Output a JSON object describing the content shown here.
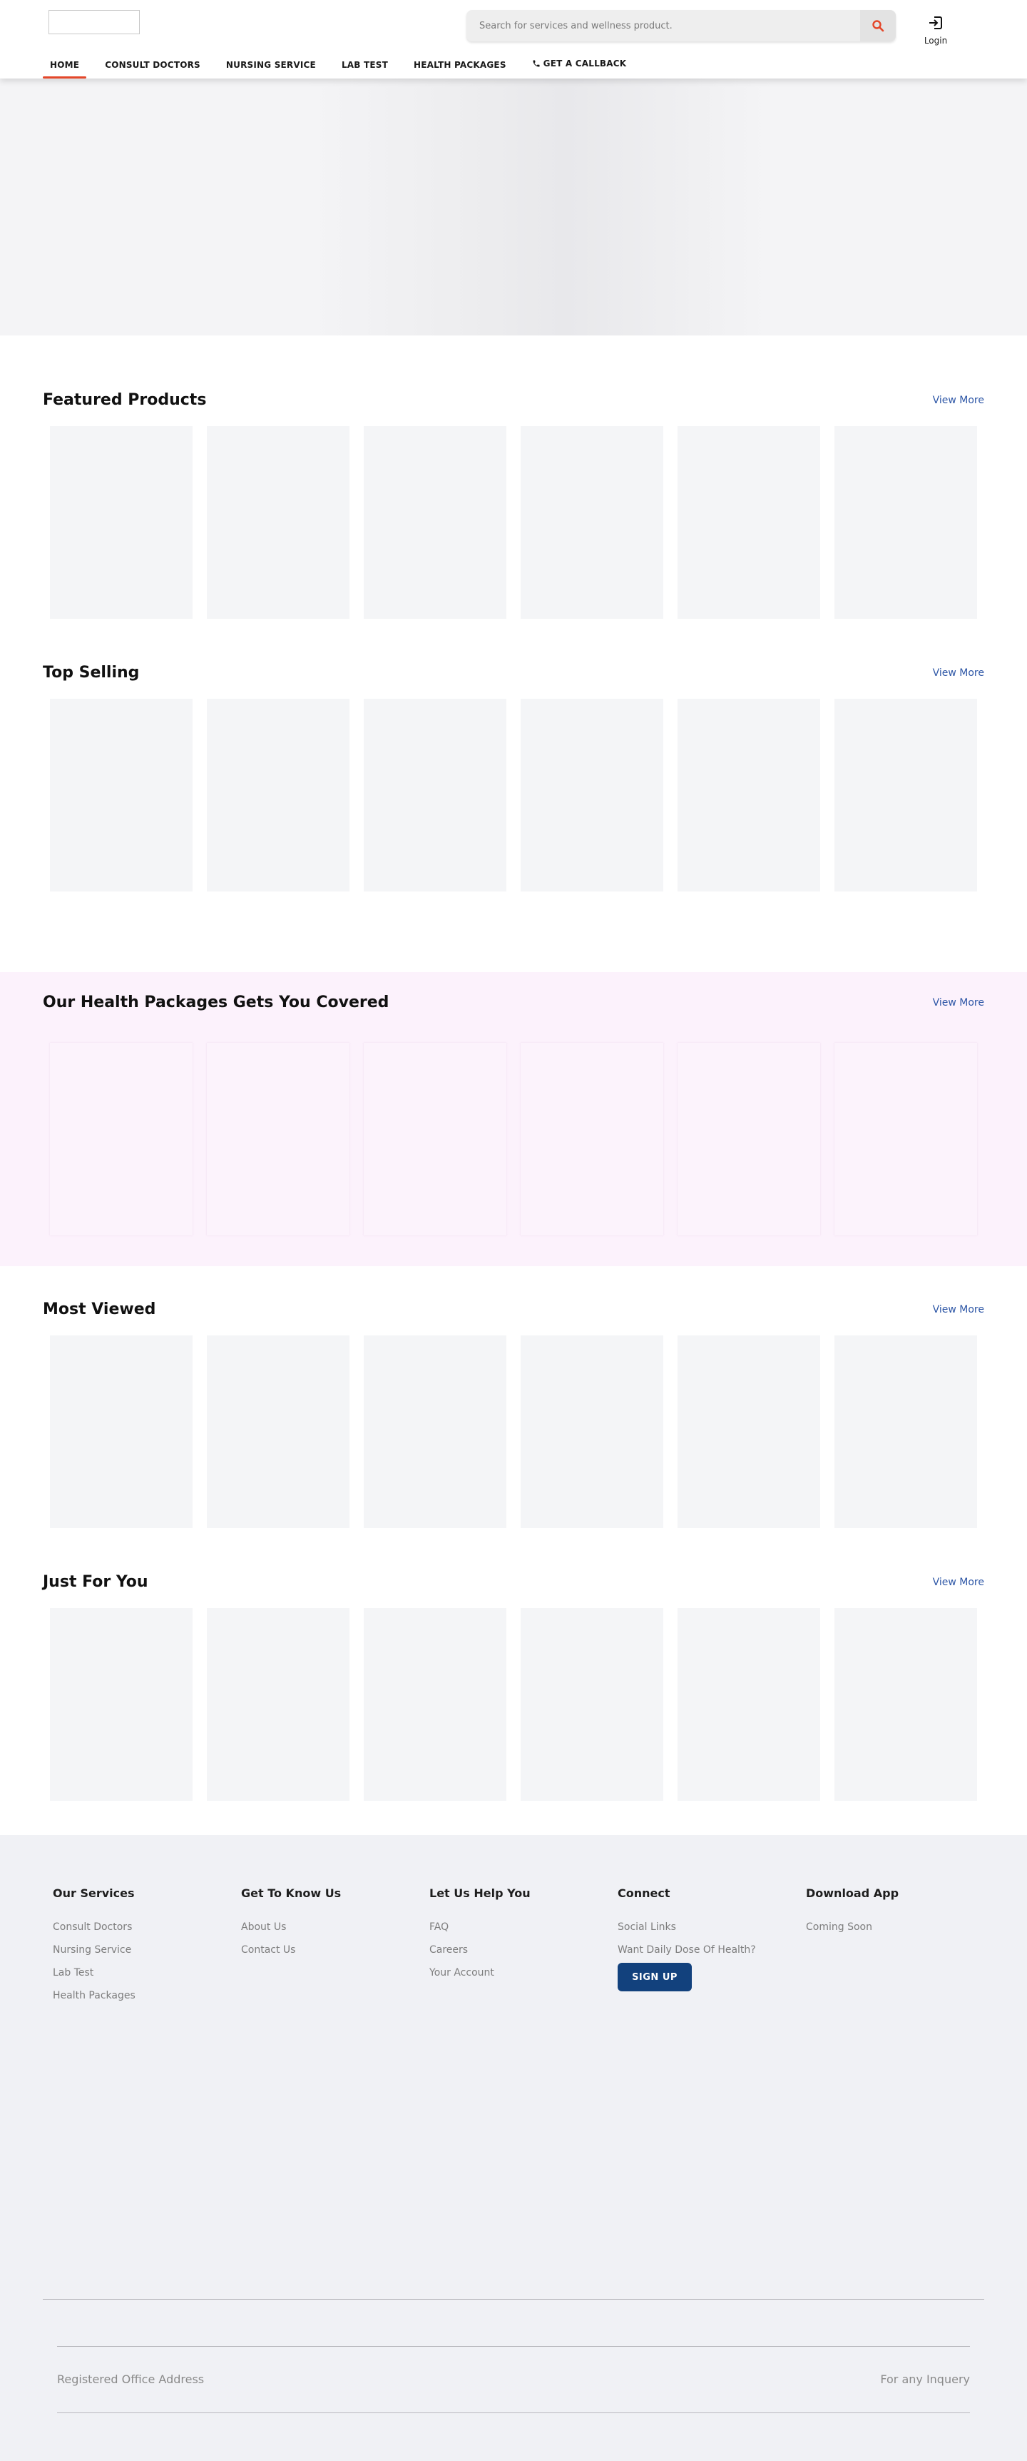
{
  "header": {
    "search_placeholder": "Search for services and wellness product.",
    "login_label": "Login",
    "accent_color": "#e4472a"
  },
  "nav": {
    "items": [
      "HOME",
      "CONSULT DOCTORS",
      "NURSING SERVICE",
      "LAB TEST",
      "HEALTH PACKAGES"
    ],
    "active": "HOME",
    "callback_label": "GET A CALLBACK"
  },
  "sections": [
    {
      "title": "Featured Products",
      "view_more": "View More"
    },
    {
      "title": "Top Selling",
      "view_more": "View More"
    },
    {
      "title": "Our Health Packages Gets You Covered",
      "view_more": "View More"
    },
    {
      "title": "Most Viewed",
      "view_more": "View More"
    },
    {
      "title": "Just For You",
      "view_more": "View More"
    }
  ],
  "footer": {
    "columns": [
      {
        "heading": "Our Services",
        "links": [
          "Consult Doctors",
          "Nursing Service",
          "Lab Test",
          "Health Packages"
        ]
      },
      {
        "heading": "Get To Know Us",
        "links": [
          "About Us",
          "Contact Us"
        ]
      },
      {
        "heading": "Let Us Help You",
        "links": [
          "FAQ",
          "Careers",
          "Your Account"
        ]
      },
      {
        "heading": "Connect",
        "links": [
          "Social Links"
        ],
        "subtext": "Want Daily Dose Of Health?",
        "button": "SIGN UP"
      },
      {
        "heading": "Download App",
        "links": [
          "Coming Soon"
        ]
      }
    ],
    "address_label": "Registered Office Address",
    "inquiry_label": "For any Inquery",
    "signup_color": "#12417d"
  }
}
